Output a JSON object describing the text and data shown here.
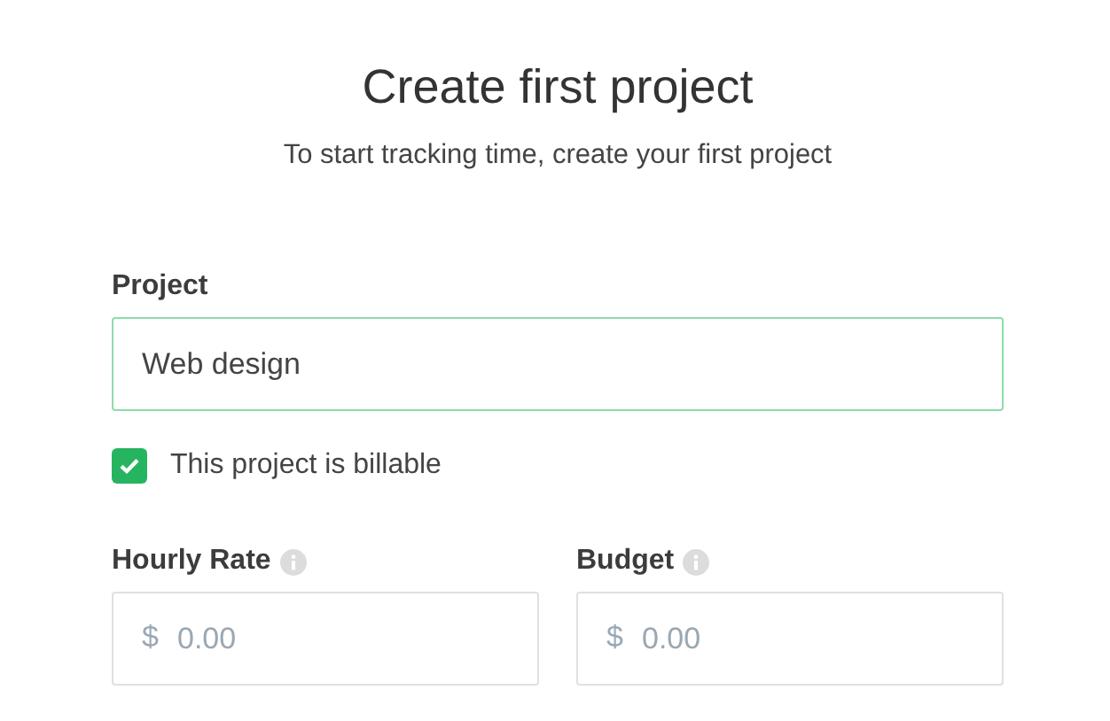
{
  "title": "Create first project",
  "subtitle": "To start tracking time, create your first project",
  "project": {
    "label": "Project",
    "value": "Web design",
    "focused": true
  },
  "billable": {
    "label": "This project is billable",
    "checked": true
  },
  "money_fields": [
    {
      "label": "Hourly Rate",
      "currency": "$",
      "placeholder": "0.00"
    },
    {
      "label": "Budget",
      "currency": "$",
      "placeholder": "0.00"
    }
  ]
}
